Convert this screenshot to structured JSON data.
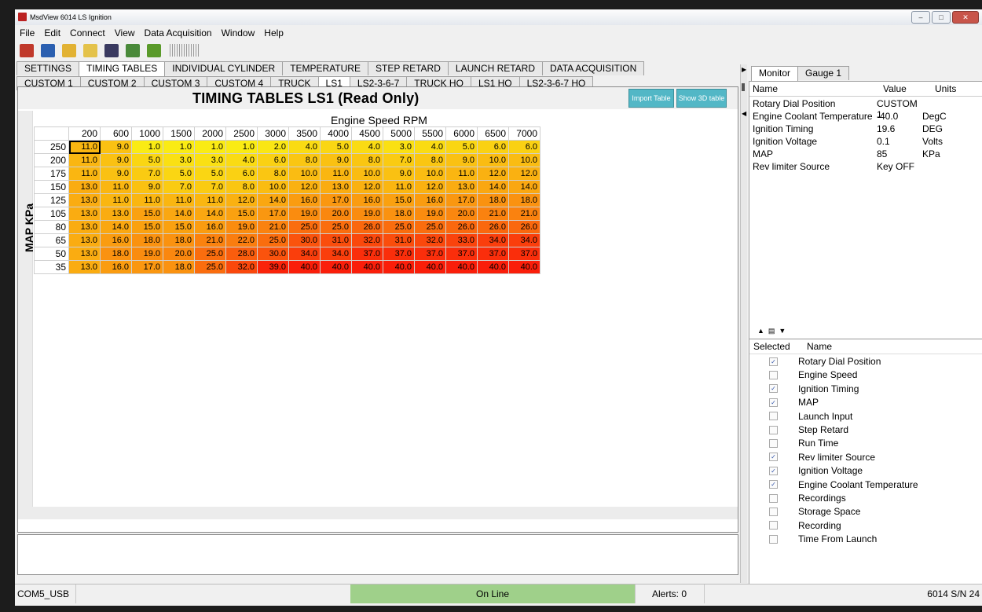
{
  "window": {
    "title": "MsdView  6014  LS Ignition",
    "buttons": [
      "–",
      "□",
      "✕"
    ]
  },
  "menu": [
    "File",
    "Edit",
    "Connect",
    "View",
    "Data Acquisition",
    "Window",
    "Help"
  ],
  "toolbar": [
    {
      "icon": "connect-icon",
      "color": "#c0392b"
    },
    {
      "icon": "chip-icon",
      "color": "#2b5fb0"
    },
    {
      "icon": "open-file-icon",
      "color": "#e2b233"
    },
    {
      "icon": "folder-icon",
      "color": "#e4c24a"
    },
    {
      "icon": "save-icon",
      "color": "#3a3a60"
    },
    {
      "icon": "grid-icon",
      "color": "#4a8a3a"
    },
    {
      "icon": "help-icon",
      "color": "#5a9a2a"
    }
  ],
  "main_tabs": [
    "SETTINGS",
    "TIMING TABLES",
    "INDIVIDUAL CYLINDER",
    "TEMPERATURE",
    "STEP RETARD",
    "LAUNCH RETARD",
    "DATA ACQUISITION"
  ],
  "main_tab_active": 1,
  "sub_tabs": [
    "CUSTOM 1",
    "CUSTOM 2",
    "CUSTOM 3",
    "CUSTOM 4",
    "TRUCK",
    "LS1",
    "LS2-3-6-7",
    "TRUCK HO",
    "LS1 HO",
    "LS2-3-6-7 HO"
  ],
  "sub_tab_active": 5,
  "heading": {
    "title": "TIMING TABLES   LS1    (Read Only)",
    "import_button": "Import Table",
    "show3d_button": "Show 3D table"
  },
  "x_axis_label": "Engine Speed  RPM",
  "y_axis_label": "MAP  KPa",
  "table": {
    "rpm": [
      "200",
      "600",
      "1000",
      "1500",
      "2000",
      "2500",
      "3000",
      "3500",
      "4000",
      "4500",
      "5000",
      "5500",
      "6000",
      "6500",
      "7000"
    ],
    "map": [
      "250",
      "200",
      "175",
      "150",
      "125",
      "105",
      "80",
      "65",
      "50",
      "35"
    ],
    "values": [
      [
        "11.0",
        "9.0",
        "1.0",
        "1.0",
        "1.0",
        "1.0",
        "2.0",
        "4.0",
        "5.0",
        "4.0",
        "3.0",
        "4.0",
        "5.0",
        "6.0",
        "6.0"
      ],
      [
        "11.0",
        "9.0",
        "5.0",
        "3.0",
        "3.0",
        "4.0",
        "6.0",
        "8.0",
        "9.0",
        "8.0",
        "7.0",
        "8.0",
        "9.0",
        "10.0",
        "10.0"
      ],
      [
        "11.0",
        "9.0",
        "7.0",
        "5.0",
        "5.0",
        "6.0",
        "8.0",
        "10.0",
        "11.0",
        "10.0",
        "9.0",
        "10.0",
        "11.0",
        "12.0",
        "12.0"
      ],
      [
        "13.0",
        "11.0",
        "9.0",
        "7.0",
        "7.0",
        "8.0",
        "10.0",
        "12.0",
        "13.0",
        "12.0",
        "11.0",
        "12.0",
        "13.0",
        "14.0",
        "14.0"
      ],
      [
        "13.0",
        "11.0",
        "11.0",
        "11.0",
        "11.0",
        "12.0",
        "14.0",
        "16.0",
        "17.0",
        "16.0",
        "15.0",
        "16.0",
        "17.0",
        "18.0",
        "18.0"
      ],
      [
        "13.0",
        "13.0",
        "15.0",
        "14.0",
        "14.0",
        "15.0",
        "17.0",
        "19.0",
        "20.0",
        "19.0",
        "18.0",
        "19.0",
        "20.0",
        "21.0",
        "21.0"
      ],
      [
        "13.0",
        "14.0",
        "15.0",
        "15.0",
        "16.0",
        "19.0",
        "21.0",
        "25.0",
        "25.0",
        "26.0",
        "25.0",
        "25.0",
        "26.0",
        "26.0",
        "26.0"
      ],
      [
        "13.0",
        "16.0",
        "18.0",
        "18.0",
        "21.0",
        "22.0",
        "25.0",
        "30.0",
        "31.0",
        "32.0",
        "31.0",
        "32.0",
        "33.0",
        "34.0",
        "34.0"
      ],
      [
        "13.0",
        "18.0",
        "19.0",
        "20.0",
        "25.0",
        "28.0",
        "30.0",
        "34.0",
        "34.0",
        "37.0",
        "37.0",
        "37.0",
        "37.0",
        "37.0",
        "37.0"
      ],
      [
        "13.0",
        "16.0",
        "17.0",
        "18.0",
        "25.0",
        "32.0",
        "39.0",
        "40.0",
        "40.0",
        "40.0",
        "40.0",
        "40.0",
        "40.0",
        "40.0",
        "40.0"
      ]
    ]
  },
  "right_tabs": [
    "Monitor",
    "Gauge 1"
  ],
  "right_tab_active": 0,
  "monitor": {
    "columns": [
      "Name",
      "Value",
      "Units"
    ],
    "rows": [
      {
        "name": "Rotary Dial Position",
        "value": "CUSTOM 1",
        "units": ""
      },
      {
        "name": "Engine Coolant Temperature",
        "value": "-40.0",
        "units": "DegC"
      },
      {
        "name": "Ignition Timing",
        "value": "19.6",
        "units": "DEG"
      },
      {
        "name": "Ignition Voltage",
        "value": "0.1",
        "units": "Volts"
      },
      {
        "name": "MAP",
        "value": "85",
        "units": "KPa"
      },
      {
        "name": "Rev limiter Source",
        "value": "Key OFF",
        "units": ""
      }
    ]
  },
  "selector": {
    "columns": [
      "Selected",
      "Name"
    ],
    "rows": [
      {
        "name": "Rotary Dial Position",
        "checked": true
      },
      {
        "name": "Engine Speed",
        "checked": false
      },
      {
        "name": "Ignition Timing",
        "checked": true
      },
      {
        "name": "MAP",
        "checked": true
      },
      {
        "name": "Launch Input",
        "checked": false
      },
      {
        "name": "Step Retard",
        "checked": false
      },
      {
        "name": "Run Time",
        "checked": false
      },
      {
        "name": "Rev limiter Source",
        "checked": true
      },
      {
        "name": "Ignition Voltage",
        "checked": true
      },
      {
        "name": "Engine Coolant Temperature",
        "checked": true
      },
      {
        "name": "Recordings",
        "checked": false
      },
      {
        "name": "Storage Space",
        "checked": false
      },
      {
        "name": "Recording",
        "checked": false
      },
      {
        "name": "Time From Launch",
        "checked": false
      }
    ]
  },
  "status": {
    "port": "COM5_USB",
    "online": "On Line",
    "online_color": "#9fd08a",
    "alerts": "Alerts: 0",
    "serial": "6014  S/N 24"
  }
}
